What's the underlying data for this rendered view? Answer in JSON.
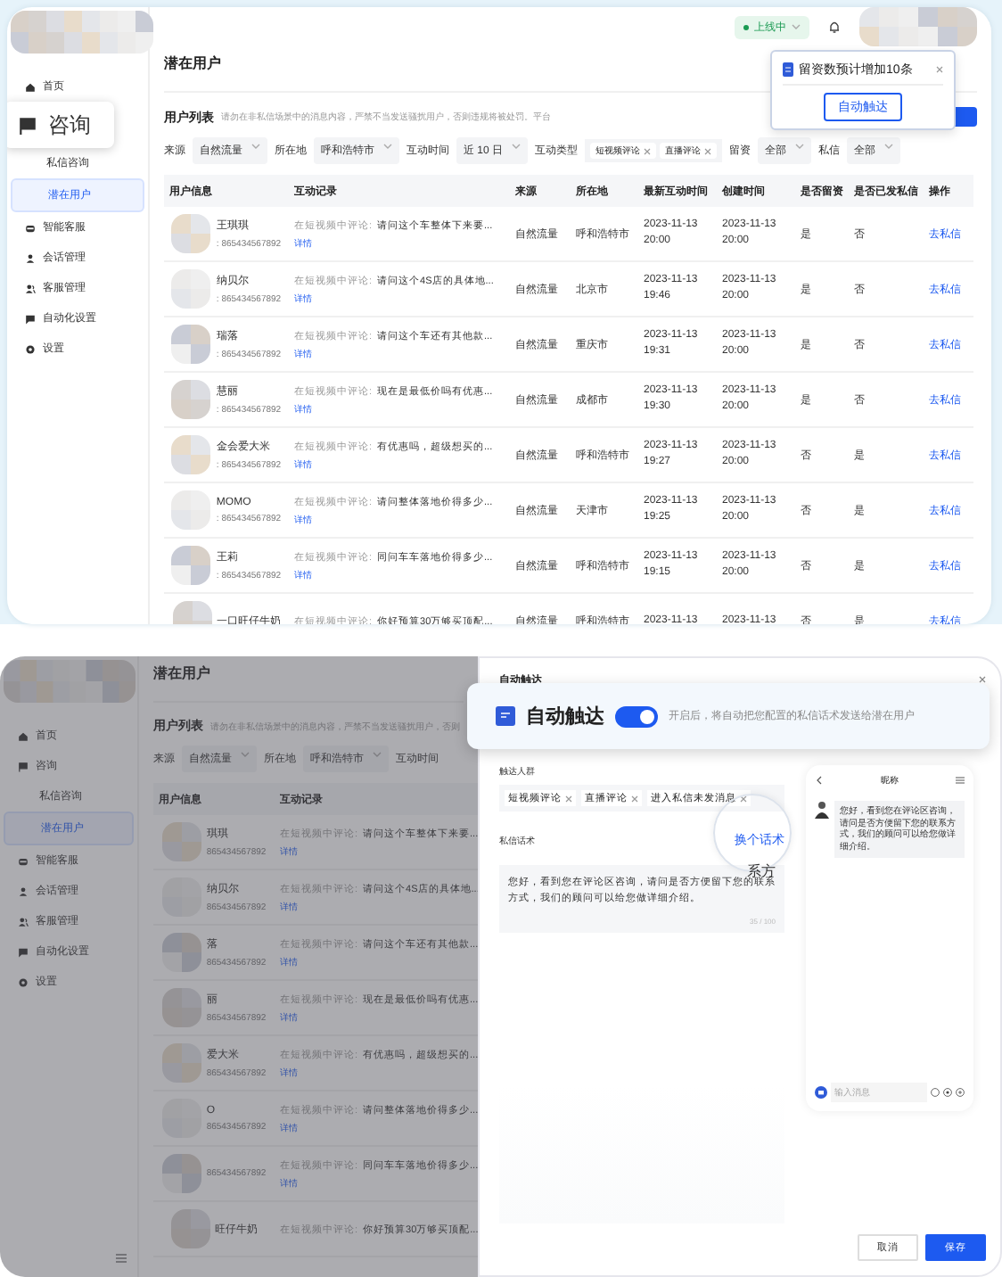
{
  "top_screen": {
    "sidebar": {
      "items": [
        {
          "label": "首页",
          "kind": "item",
          "selected": false
        },
        {
          "label": "咨询",
          "kind": "callout",
          "selected": false
        },
        {
          "label": "私信咨询",
          "kind": "sub",
          "selected": false
        },
        {
          "label": "潜在用户",
          "kind": "sub",
          "selected": true
        },
        {
          "label": "智能客服",
          "kind": "item",
          "selected": false
        },
        {
          "label": "会话管理",
          "kind": "item",
          "selected": false
        },
        {
          "label": "客服管理",
          "kind": "item",
          "selected": false
        },
        {
          "label": "自动化设置",
          "kind": "item",
          "selected": false
        },
        {
          "label": "设置",
          "kind": "item",
          "selected": false
        }
      ]
    },
    "header": {
      "status": "上线中"
    },
    "popover": {
      "message": "留资数预计增加10条",
      "button": "自动触达"
    },
    "page_title": "潜在用户",
    "list_title": "用户列表",
    "list_note": "请勿在非私信场景中的消息内容，严禁不当发送骚扰用户，否则违规将被处罚。平台",
    "filters": [
      {
        "label": "来源",
        "kind": "select",
        "value": "自然流量"
      },
      {
        "label": "所在地",
        "kind": "select",
        "value": "呼和浩特市"
      },
      {
        "label": "互动时间",
        "kind": "select",
        "value": "近 10 日"
      },
      {
        "label": "互动类型",
        "kind": "tags",
        "tags": [
          "短视频评论",
          "直播评论"
        ]
      },
      {
        "label": "留资",
        "kind": "select",
        "value": "全部"
      },
      {
        "label": "私信",
        "kind": "select",
        "value": "全部"
      }
    ],
    "table": {
      "columns": [
        "用户信息",
        "互动记录",
        "来源",
        "所在地",
        "最新互动时间",
        "创建时间",
        "是否留资",
        "是否已发私信",
        "操作"
      ],
      "rows": [
        {
          "name": "王琪琪",
          "id": ": 865434567892",
          "prefix": "在短视频中评论:",
          "comment": "请问这个车整体下来要...",
          "detail": "详情",
          "source": "自然流量",
          "location": "呼和浩特市",
          "latest": "2023-11-13 20:00",
          "created": "2023-11-13 20:00",
          "lead": "是",
          "messaged": "否",
          "action": "去私信"
        },
        {
          "name": "纳贝尔",
          "id": ": 865434567892",
          "prefix": "在短视频中评论:",
          "comment": "请问这个4S店的具体地...",
          "detail": "详情",
          "source": "自然流量",
          "location": "北京市",
          "latest": "2023-11-13 19:46",
          "created": "2023-11-13 20:00",
          "lead": "是",
          "messaged": "否",
          "action": "去私信"
        },
        {
          "name": "瑞落",
          "id": ": 865434567892",
          "prefix": "在短视频中评论:",
          "comment": "请问这个车还有其他款...",
          "detail": "详情",
          "source": "自然流量",
          "location": "重庆市",
          "latest": "2023-11-13 19:31",
          "created": "2023-11-13 20:00",
          "lead": "是",
          "messaged": "否",
          "action": "去私信"
        },
        {
          "name": "慧丽",
          "id": ": 865434567892",
          "prefix": "在短视频中评论:",
          "comment": "现在是最低价吗有优惠...",
          "detail": "详情",
          "source": "自然流量",
          "location": "成都市",
          "latest": "2023-11-13 19:30",
          "created": "2023-11-13 20:00",
          "lead": "是",
          "messaged": "否",
          "action": "去私信"
        },
        {
          "name": "金会爱大米",
          "id": ": 865434567892",
          "prefix": "在短视频中评论:",
          "comment": "有优惠吗，超级想买的...",
          "detail": "详情",
          "source": "自然流量",
          "location": "呼和浩特市",
          "latest": "2023-11-13 19:27",
          "created": "2023-11-13 20:00",
          "lead": "否",
          "messaged": "是",
          "action": "去私信"
        },
        {
          "name": "MOMO",
          "id": ": 865434567892",
          "prefix": "在短视频中评论:",
          "comment": "请问整体落地价得多少...",
          "detail": "详情",
          "source": "自然流量",
          "location": "天津市",
          "latest": "2023-11-13 19:25",
          "created": "2023-11-13 20:00",
          "lead": "否",
          "messaged": "是",
          "action": "去私信"
        },
        {
          "name": "王莉",
          "id": ": 865434567892",
          "prefix": "在短视频中评论:",
          "comment": "同问车车落地价得多少...",
          "detail": "详情",
          "source": "自然流量",
          "location": "呼和浩特市",
          "latest": "2023-11-13 19:15",
          "created": "2023-11-13 20:00",
          "lead": "否",
          "messaged": "是",
          "action": "去私信"
        },
        {
          "name": "一口旺仔牛奶",
          "prefix": "在短视频中评论:",
          "comment": "你好预算30万够买顶配...",
          "source": "自然流量",
          "location": "呼和浩特市",
          "latest": "2023-11-13",
          "created": "2023-11-13",
          "lead": "否",
          "messaged": "是",
          "action": "去私信"
        }
      ]
    }
  },
  "bottom_screen": {
    "sidebar": {
      "items": [
        {
          "label": "首页",
          "kind": "item",
          "selected": false
        },
        {
          "label": "咨询",
          "kind": "item",
          "selected": false
        },
        {
          "label": "私信咨询",
          "kind": "sub",
          "selected": false
        },
        {
          "label": "潜在用户",
          "kind": "sub",
          "selected": true
        },
        {
          "label": "智能客服",
          "kind": "item",
          "selected": false
        },
        {
          "label": "会话管理",
          "kind": "item",
          "selected": false
        },
        {
          "label": "客服管理",
          "kind": "item",
          "selected": false
        },
        {
          "label": "自动化设置",
          "kind": "item",
          "selected": false
        },
        {
          "label": "设置",
          "kind": "item",
          "selected": false
        }
      ]
    },
    "page_title": "潜在用户",
    "list_title": "用户列表",
    "list_note": "请勿在非私信场景中的消息内容，严禁不当发送骚扰用户，否则",
    "filters": [
      {
        "label": "来源",
        "kind": "select",
        "value": "自然流量"
      },
      {
        "label": "所在地",
        "kind": "select",
        "value": "呼和浩特市"
      },
      {
        "label": "互动时间",
        "kind": "select"
      }
    ],
    "table": {
      "columns": [
        "用户信息",
        "互动记录"
      ],
      "rows": [
        {
          "name": "琪琪",
          "id": "865434567892",
          "prefix": "在短视频中评论:",
          "comment": "请问这个车整体下来要...",
          "detail": "详情"
        },
        {
          "name": "纳贝尔",
          "id": "865434567892",
          "prefix": "在短视频中评论:",
          "comment": "请问这个4S店的具体地...",
          "detail": "详情"
        },
        {
          "name": "落",
          "id": "865434567892",
          "prefix": "在短视频中评论:",
          "comment": "请问这个车还有其他款...",
          "detail": "详情"
        },
        {
          "name": "丽",
          "id": "865434567892",
          "prefix": "在短视频中评论:",
          "comment": "现在是最低价吗有优惠...",
          "detail": "详情"
        },
        {
          "name": "爱大米",
          "id": "865434567892",
          "prefix": "在短视频中评论:",
          "comment": "有优惠吗，超级想买的...",
          "detail": "详情"
        },
        {
          "name": "O",
          "id": "865434567892",
          "prefix": "在短视频中评论:",
          "comment": "请问整体落地价得多少...",
          "detail": "详情"
        },
        {
          "id": "865434567892",
          "prefix": "在短视频中评论:",
          "comment": "同问车车落地价得多少...",
          "detail": "详情"
        },
        {
          "name": "旺仔牛奶",
          "prefix": "在短视频中评论:",
          "comment": "你好预算30万够买顶配..."
        }
      ]
    },
    "drawer": {
      "title": "自动触达",
      "feature": {
        "label": "自动触达",
        "on": true,
        "description": "开启后，将自动把您配置的私信话术发送给潜在用户"
      },
      "audience_label": "触达人群",
      "audience_tags": [
        "短视频评论",
        "直播评论",
        "进入私信未发消息"
      ],
      "script_label": "私信话术",
      "switch_link": "换个话术",
      "lens_text": "系方",
      "message": "您好，看到您在评论区咨询，请问是否方便留下您的联系方式，我们的顾问可以给您做详细介绍。",
      "counter": "35 / 100",
      "preview": {
        "title": "昵称",
        "bubble": "您好，看到您在评论区咨询，请问是否方便留下您的联系方式，我们的顾问可以给您做详细介绍。",
        "input_placeholder": "输入消息"
      },
      "buttons": [
        {
          "label": "取消",
          "kind": "secondary"
        },
        {
          "label": "保存",
          "kind": "primary"
        }
      ]
    }
  }
}
